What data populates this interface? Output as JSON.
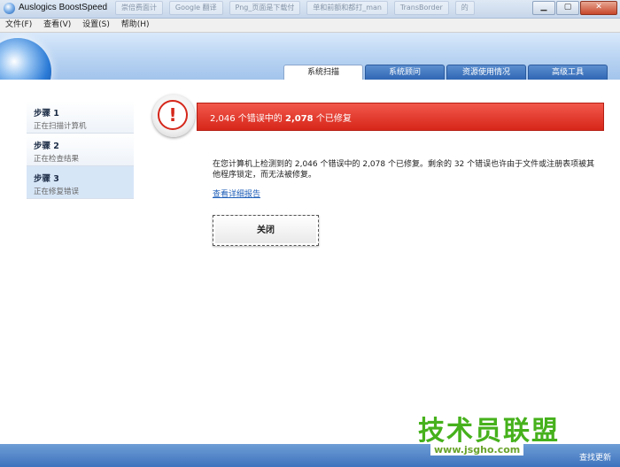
{
  "window": {
    "title": "Auslogics BoostSpeed",
    "bg_tabs": [
      "崇倍费面计",
      "Google 翻译",
      "Png_页面是下载付",
      "单和前额和都打_man",
      "TransBorder",
      "的"
    ],
    "controls": {
      "minimize": "▁",
      "maximize": "▢",
      "close": "✕"
    }
  },
  "menu": [
    "文件(F)",
    "查看(V)",
    "设置(S)",
    "帮助(H)"
  ],
  "tabs": [
    {
      "label": "系统扫描",
      "active": true
    },
    {
      "label": "系统顾问",
      "active": false
    },
    {
      "label": "资源使用情况",
      "active": false
    },
    {
      "label": "高级工具",
      "active": false
    }
  ],
  "steps": [
    {
      "title": "步骤 1",
      "sub": "正在扫描计算机",
      "active": false
    },
    {
      "title": "步骤 2",
      "sub": "正在检查结果",
      "active": false
    },
    {
      "title": "步骤 3",
      "sub": "正在修复错误",
      "active": true
    }
  ],
  "result": {
    "icon": "!",
    "part1": "2,046 个错误中的 ",
    "bold": "2,078",
    "part2": " 个已修复"
  },
  "description": {
    "line1": "在您计算机上检测到的 2,046 个错误中的 2,078 个已修复。剩余的 32 个错误也许由于文件或注册表项被其",
    "line2": "他程序锁定，而无法被修复。"
  },
  "report_link": "查看详细报告",
  "close_button": "关闭",
  "footer": {
    "update": "查找更新"
  },
  "watermark": {
    "big": "技术员联盟",
    "url": "www.jsgho.com"
  },
  "colors": {
    "accent": "#2f66b4",
    "error": "#d7261a",
    "link": "#1f5fb8"
  }
}
